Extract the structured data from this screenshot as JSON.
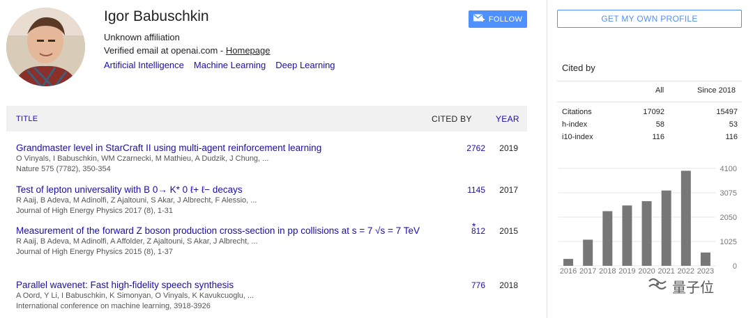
{
  "profile": {
    "name": "Igor Babuschkin",
    "affiliation": "Unknown affiliation",
    "email_text": "Verified email at openai.com - ",
    "homepage_label": "Homepage",
    "interests": [
      "Artificial Intelligence",
      "Machine Learning",
      "Deep Learning"
    ]
  },
  "buttons": {
    "follow": "FOLLOW",
    "own_profile": "GET MY OWN PROFILE"
  },
  "table": {
    "headers": {
      "title": "TITLE",
      "cited_by": "CITED BY",
      "year": "YEAR"
    },
    "rows": [
      {
        "title": "Grandmaster level in StarCraft II using multi-agent reinforcement learning",
        "authors": "O Vinyals, I Babuschkin, WM Czarnecki, M Mathieu, A Dudzik, J Chung, ...",
        "venue": "Nature 575 (7782), 350-354",
        "cited": "2762",
        "year": "2019"
      },
      {
        "title": "Test of lepton universality with B 0→ K* 0 ℓ+ ℓ− decays",
        "authors": "R Aaij, B Adeva, M Adinolfi, Z Ajaltouni, S Akar, J Albrecht, F Alessio, ...",
        "venue": "Journal of High Energy Physics 2017 (8), 1-31",
        "cited": "1145",
        "year": "2017"
      },
      {
        "title": "Measurement of the forward Z boson production cross-section in pp collisions at s = 7 √s = 7 TeV",
        "authors": "R Aaij, B Adeva, M Adinolfi, A Affolder, Z Ajaltouni, S Akar, J Albrecht, ...",
        "venue": "Journal of High Energy Physics 2015 (8), 1-37",
        "cited": "812",
        "star": "*",
        "year": "2015"
      },
      {
        "title": "Parallel wavenet: Fast high-fidelity speech synthesis",
        "authors": "A Oord, Y Li, I Babuschkin, K Simonyan, O Vinyals, K Kavukcuoglu, ...",
        "venue": "International conference on machine learning, 3918-3926",
        "cited": "776",
        "year": "2018"
      }
    ]
  },
  "cited_by": {
    "label": "Cited by",
    "columns": [
      "All",
      "Since 2018"
    ],
    "rows": [
      {
        "label": "Citations",
        "all": "17092",
        "since": "15497"
      },
      {
        "label": "h-index",
        "all": "58",
        "since": "53"
      },
      {
        "label": "i10-index",
        "all": "116",
        "since": "116"
      }
    ]
  },
  "chart_data": {
    "type": "bar",
    "categories": [
      "2016",
      "2017",
      "2018",
      "2019",
      "2020",
      "2021",
      "2022",
      "2023"
    ],
    "values": [
      290,
      1100,
      2300,
      2540,
      2720,
      3170,
      4000,
      560
    ],
    "yticks": [
      "4100",
      "3075",
      "2050",
      "1025",
      "0"
    ],
    "ylim": [
      0,
      4100
    ],
    "bar_color": "#777777",
    "grid": true
  },
  "watermark": {
    "text": "量子位"
  },
  "colors": {
    "link": "#1a0dab",
    "accent": "#4d90fe",
    "header_bg": "#f1f1f1"
  }
}
